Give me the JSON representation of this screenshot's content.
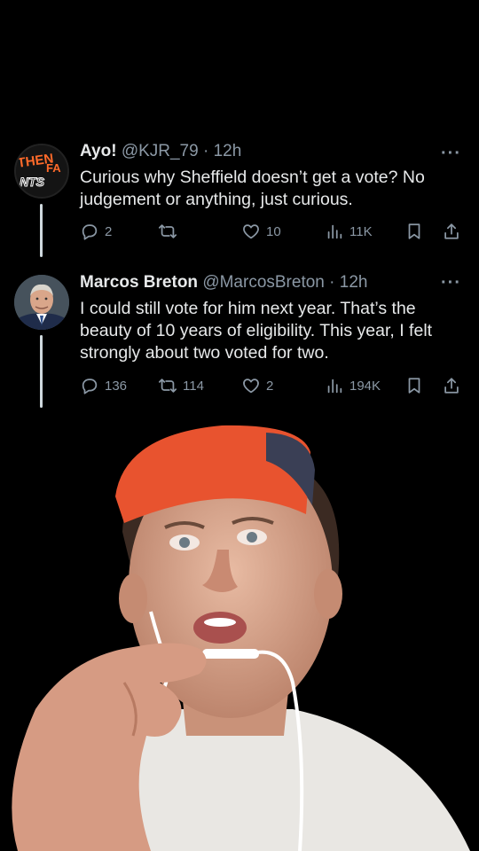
{
  "tweets": [
    {
      "name": "Ayo!",
      "handle": "@KJR_79",
      "time": "12h",
      "text": "Curious why Sheffield doesn’t get a vote? No judgement or anything, just curious.",
      "avatar_text": [
        "THEN",
        "FA",
        "NTS"
      ],
      "replies": "2",
      "retweets": "",
      "likes": "10",
      "views": "11K"
    },
    {
      "name": "Marcos Breton",
      "handle": "@MarcosBreton",
      "time": "12h",
      "text": "I could still vote for him next year. That’s the beauty of 10 years of eligibility. This year, I felt strongly about two voted for two.",
      "replies": "136",
      "retweets": "114",
      "likes": "2",
      "views": "194K"
    }
  ],
  "colors": {
    "background": "#000000",
    "text": "#e7e9ea",
    "muted": "#8b98a5",
    "avatar_text": "#ff6a2a",
    "cap": "#e8532f"
  },
  "icons": [
    "reply-icon",
    "retweet-icon",
    "like-icon",
    "views-icon",
    "bookmark-icon",
    "share-icon",
    "more-icon"
  ]
}
